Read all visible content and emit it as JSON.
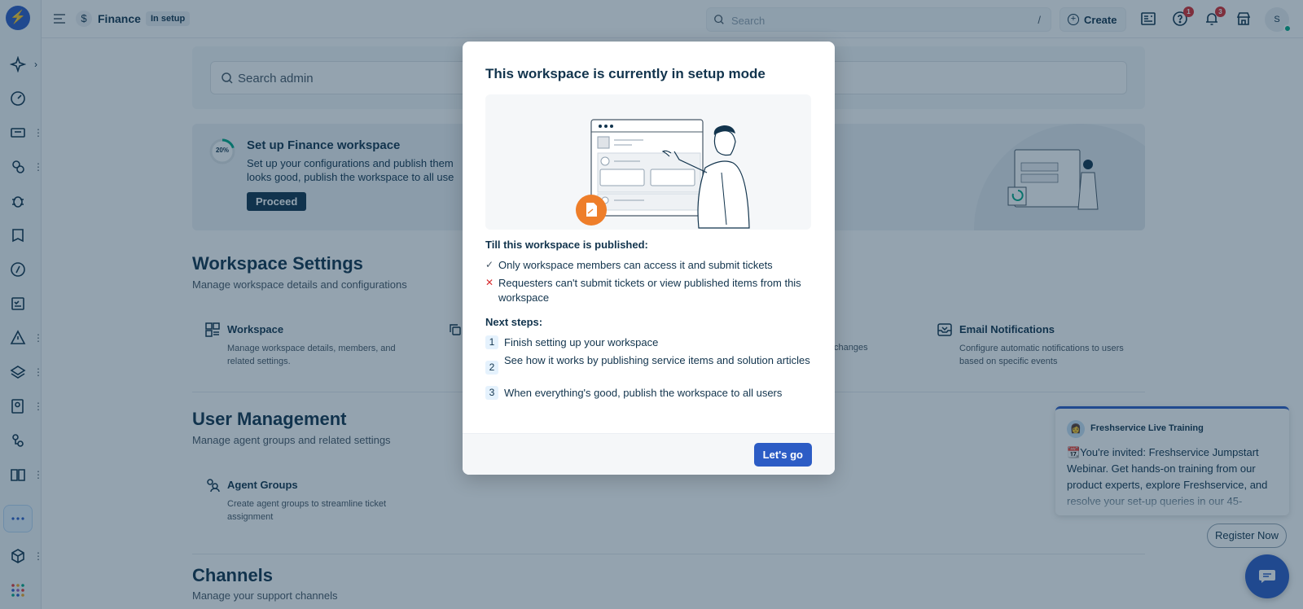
{
  "app": {
    "workspace_name": "Finance",
    "workspace_status": "In setup",
    "search_placeholder": "Search",
    "search_shortcut": "/",
    "create_label": "Create",
    "help_count": "1",
    "notifications_count": "3",
    "avatar_initial": "S",
    "accent_color": "#2c5cc5"
  },
  "main": {
    "search_admin_placeholder": "Search admin",
    "setup": {
      "progress_label": "20%",
      "progress_value": 0.2,
      "title": "Set up Finance workspace",
      "description": "Set up your configurations and publish them looks good, publish the workspace to all use",
      "proceed_label": "Proceed"
    },
    "workspace_settings": {
      "title": "Workspace Settings",
      "subtitle": "Manage workspace details and configurations",
      "tiles": [
        {
          "title": "Workspace",
          "desc": "Manage workspace details, members, and related settings."
        },
        {
          "title": "Email Notifications",
          "desc": "Configure automatic notifications to users based on specific events"
        }
      ],
      "partial_text": "changes"
    },
    "user_management": {
      "title": "User Management",
      "subtitle": "Manage agent groups and related settings",
      "tiles": [
        {
          "title": "Agent Groups",
          "desc": "Create agent groups to streamline ticket assignment"
        }
      ]
    },
    "channels": {
      "title": "Channels",
      "subtitle": "Manage your support channels"
    }
  },
  "training": {
    "title": "Freshservice Live Training",
    "body": "📆You're invited: Freshservice Jumpstart Webinar. Get hands-on training from our product experts, explore Freshservice, and resolve your set-up queries in our 45-",
    "register_label": "Register Now"
  },
  "modal": {
    "title": "This workspace is currently in setup mode",
    "until_heading": "Till this workspace is published:",
    "points": [
      {
        "type": "allowed",
        "text": "Only workspace members can access it and submit tickets"
      },
      {
        "type": "blocked",
        "text": "Requesters can't submit tickets or view published items from this workspace"
      }
    ],
    "next_heading": "Next steps:",
    "steps": [
      {
        "num": "1",
        "text": "Finish setting up your workspace"
      },
      {
        "num": "2",
        "text": "See how it works by publishing service items and solution articles"
      },
      {
        "num": "3",
        "text": "When everything's good, publish the workspace to all users"
      }
    ],
    "cta_label": "Let's go"
  }
}
